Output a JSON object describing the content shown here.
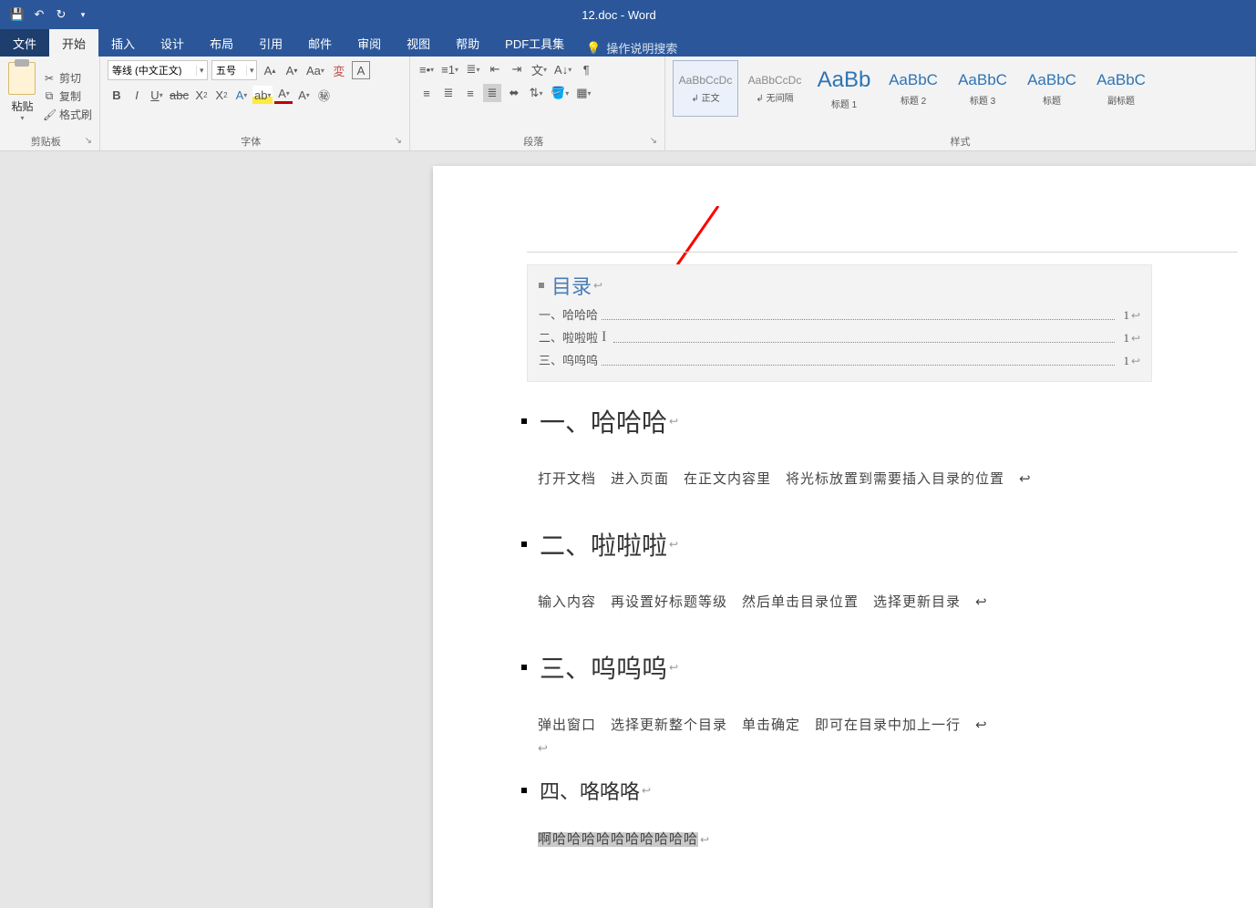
{
  "title": "12.doc - Word",
  "tabs": {
    "file": "文件",
    "home": "开始",
    "insert": "插入",
    "design": "设计",
    "layout": "布局",
    "references": "引用",
    "mailings": "邮件",
    "review": "审阅",
    "view": "视图",
    "help": "帮助",
    "pdf": "PDF工具集",
    "tellme": "操作说明搜索"
  },
  "clipboard": {
    "paste": "粘贴",
    "cut": "剪切",
    "copy": "复制",
    "format_painter": "格式刷",
    "label": "剪贴板"
  },
  "font": {
    "name": "等线 (中文正文)",
    "size": "五号",
    "label": "字体"
  },
  "paragraph": {
    "label": "段落"
  },
  "styles": {
    "label": "样式",
    "items": [
      {
        "preview": "AaBbCcDc",
        "label": "↲ 正文",
        "cls": ""
      },
      {
        "preview": "AaBbCcDc",
        "label": "↲ 无间隔",
        "cls": ""
      },
      {
        "preview": "AaBb",
        "label": "标题 1",
        "cls": "big"
      },
      {
        "preview": "AaBbC",
        "label": "标题 2",
        "cls": "head"
      },
      {
        "preview": "AaBbC",
        "label": "标题 3",
        "cls": "head"
      },
      {
        "preview": "AaBbC",
        "label": "标题",
        "cls": "head"
      },
      {
        "preview": "AaBbC",
        "label": "副标题",
        "cls": "head"
      }
    ]
  },
  "doc": {
    "toc_title": "目录",
    "toc": [
      {
        "text": "一、哈哈哈",
        "page": "1"
      },
      {
        "text": "二、啦啦啦",
        "page": "1"
      },
      {
        "text": "三、呜呜呜",
        "page": "1"
      }
    ],
    "h1": "一、哈哈哈",
    "p1": "打开文档　进入页面　在正文内容里　将光标放置到需要插入目录的位置　↩",
    "h2": "二、啦啦啦",
    "p2": "输入内容　再设置好标题等级　然后单击目录位置　选择更新目录　↩",
    "h3": "三、呜呜呜",
    "p3": "弹出窗口　选择更新整个目录　单击确定　即可在目录中加上一行　↩",
    "h4": "四、咯咯咯",
    "p4": "啊哈哈哈哈哈哈哈哈哈哈"
  }
}
